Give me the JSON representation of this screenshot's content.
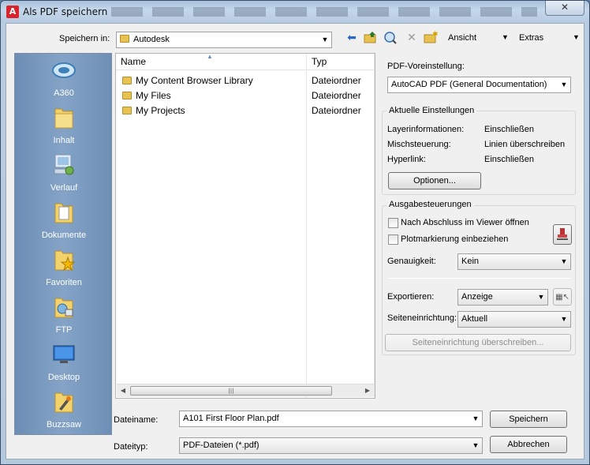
{
  "window": {
    "title": "Als PDF speichern",
    "close_glyph": "✕"
  },
  "toolbar": {
    "save_in_label": "Speichern in:",
    "location": "Autodesk",
    "views_label": "Ansicht",
    "tools_label": "Extras"
  },
  "places": [
    {
      "label": "A360",
      "icon": "a360-icon"
    },
    {
      "label": "Inhalt",
      "icon": "folder-icon"
    },
    {
      "label": "Verlauf",
      "icon": "history-icon"
    },
    {
      "label": "Dokumente",
      "icon": "documents-icon"
    },
    {
      "label": "Favoriten",
      "icon": "favorites-icon"
    },
    {
      "label": "FTP",
      "icon": "ftp-icon"
    },
    {
      "label": "Desktop",
      "icon": "desktop-icon"
    },
    {
      "label": "Buzzsaw",
      "icon": "buzzsaw-icon"
    }
  ],
  "filelist": {
    "columns": {
      "name": "Name",
      "type": "Typ"
    },
    "rows": [
      {
        "name": "My Content Browser Library",
        "type": "Dateiordner"
      },
      {
        "name": "My Files",
        "type": "Dateiordner"
      },
      {
        "name": "My Projects",
        "type": "Dateiordner"
      }
    ]
  },
  "pdf": {
    "preset_label": "PDF-Voreinstellung:",
    "preset_value": "AutoCAD PDF (General Documentation)",
    "current_settings": {
      "title": "Aktuelle Einstellungen",
      "layer_label": "Layerinformationen:",
      "layer_value": "Einschließen",
      "merge_label": "Mischsteuerung:",
      "merge_value": "Linien überschreiben",
      "hyperlink_label": "Hyperlink:",
      "hyperlink_value": "Einschließen",
      "options_button": "Optionen..."
    },
    "output": {
      "title": "Ausgabesteuerungen",
      "open_viewer_label": "Nach Abschluss im Viewer öffnen",
      "plot_stamp_label": "Plotmarkierung einbeziehen",
      "precision_label": "Genauigkeit:",
      "precision_value": "Kein",
      "export_label": "Exportieren:",
      "export_value": "Anzeige",
      "page_setup_label": "Seiteneinrichtung:",
      "page_setup_value": "Aktuell",
      "override_button": "Seiteneinrichtung überschreiben..."
    }
  },
  "bottom": {
    "filename_label": "Dateiname:",
    "filename_value": "A101 First Floor Plan.pdf",
    "filetype_label": "Dateityp:",
    "filetype_value": "PDF-Dateien (*.pdf)",
    "save_button": "Speichern",
    "cancel_button": "Abbrechen"
  }
}
